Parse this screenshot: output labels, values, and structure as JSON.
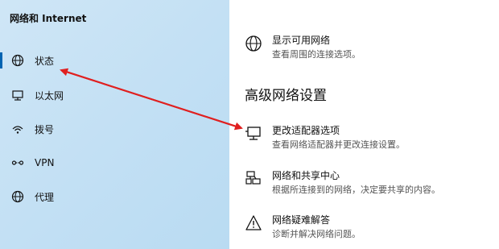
{
  "sidebar": {
    "title": "网络和 Internet",
    "items": [
      {
        "label": "状态",
        "icon": "status-globe-icon"
      },
      {
        "label": "以太网",
        "icon": "ethernet-icon"
      },
      {
        "label": "拨号",
        "icon": "dialup-icon"
      },
      {
        "label": "VPN",
        "icon": "vpn-icon"
      },
      {
        "label": "代理",
        "icon": "globe-icon"
      }
    ]
  },
  "main": {
    "show_networks": {
      "title": "显示可用网络",
      "subtitle": "查看周围的连接选项。",
      "icon": "globe-icon"
    },
    "advanced_heading": "高级网络设置",
    "adapter_options": {
      "title": "更改适配器选项",
      "subtitle": "查看网络适配器并更改连接设置。",
      "icon": "monitor-network-icon"
    },
    "sharing_center": {
      "title": "网络和共享中心",
      "subtitle": "根据所连接到的网络，决定要共享的内容。",
      "icon": "network-sharing-icon"
    },
    "troubleshooter": {
      "title": "网络疑难解答",
      "subtitle": "诊断并解决网络问题。",
      "icon": "warning-triangle-icon"
    }
  },
  "annotation": {
    "arrow_color": "#e02020"
  }
}
